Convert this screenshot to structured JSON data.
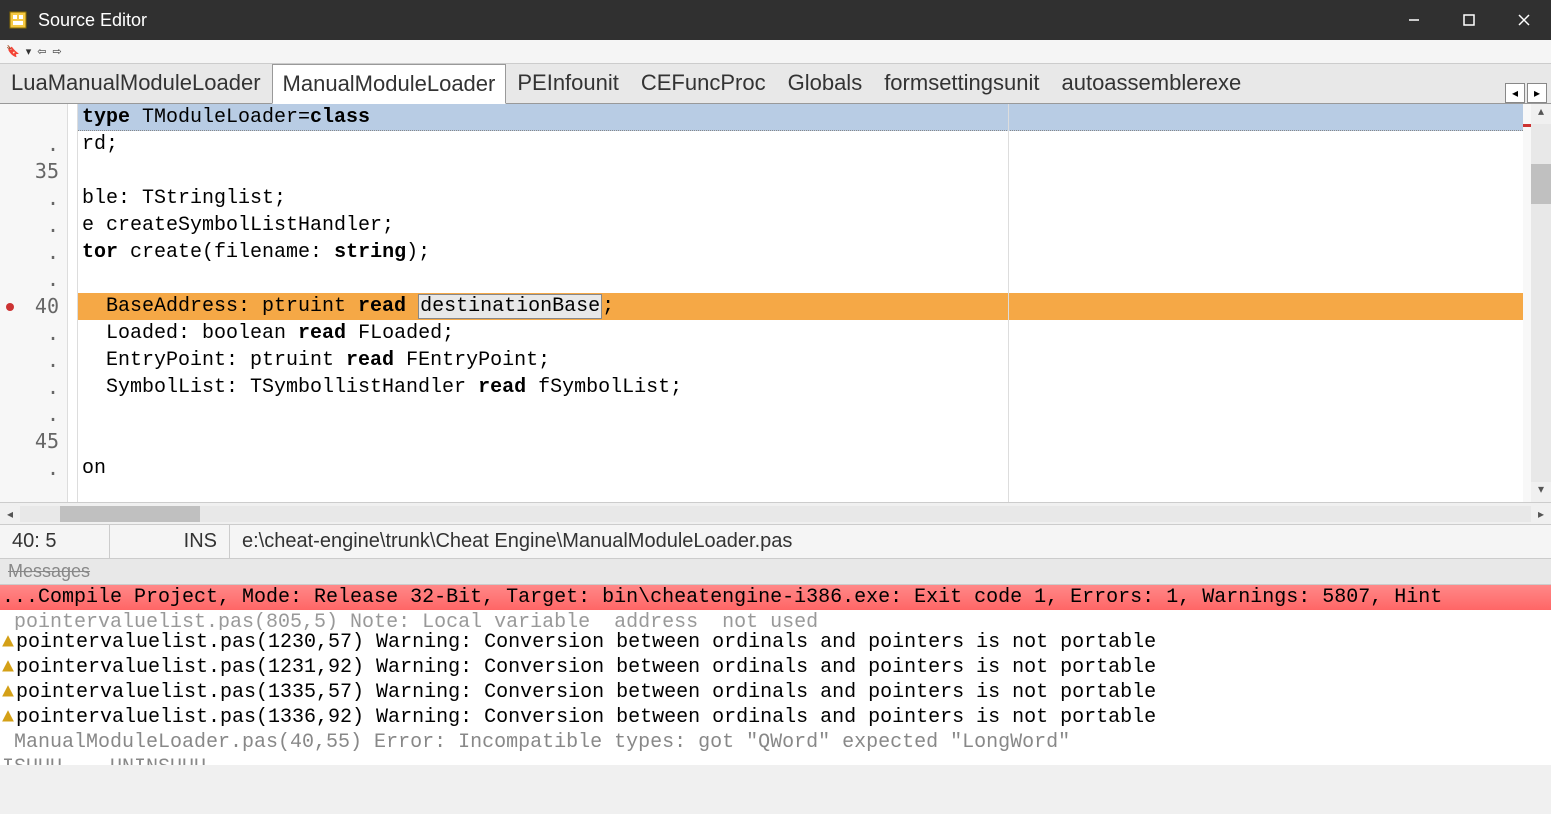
{
  "window": {
    "title": "Source Editor"
  },
  "tabs": {
    "items": [
      {
        "label": "LuaManualModuleLoader"
      },
      {
        "label": "ManualModuleLoader"
      },
      {
        "label": "PEInfounit"
      },
      {
        "label": "CEFuncProc"
      },
      {
        "label": "Globals"
      },
      {
        "label": "formsettingsunit"
      },
      {
        "label": "autoassemblerexe"
      }
    ],
    "active_index": 1
  },
  "editor": {
    "header": {
      "pre": "type ",
      "mid": "TModuleLoader=",
      "post": "class"
    },
    "lines": [
      {
        "num": ".",
        "text": "rd;"
      },
      {
        "num": "35",
        "text": ""
      },
      {
        "num": ".",
        "text": "ble: TStringlist;"
      },
      {
        "num": ".",
        "text": "e createSymbolListHandler;"
      },
      {
        "num": ".",
        "pre": "tor create(filename: ",
        "kw": "string",
        "post": ");"
      },
      {
        "num": ".",
        "text": ""
      },
      {
        "num": "40",
        "error": true,
        "hl": true,
        "pre": "  BaseAddress: ptruint ",
        "kw": "read",
        "cursor": "destinationBase",
        "post": ";"
      },
      {
        "num": ".",
        "pre": "  Loaded: boolean ",
        "kw": "read",
        "post": " FLoaded;"
      },
      {
        "num": ".",
        "pre": "  EntryPoint: ptruint ",
        "kw": "read",
        "post": " FEntryPoint;"
      },
      {
        "num": ".",
        "pre": "  SymbolList: TSymbollistHandler ",
        "kw": "read",
        "post": " fSymbolList;"
      },
      {
        "num": ".",
        "text": ""
      },
      {
        "num": "45",
        "text": ""
      },
      {
        "num": ".",
        "text": "on"
      }
    ]
  },
  "status": {
    "pos": "40: 5",
    "mode": "INS",
    "path": "e:\\cheat-engine\\trunk\\Cheat Engine\\ManualModuleLoader.pas"
  },
  "messages_title": "Messages",
  "messages": {
    "compile": "...Compile Project, Mode: Release 32-Bit, Target: bin\\cheatengine-i386.exe: Exit code 1, Errors: 1, Warnings: 5807, Hint",
    "faded": " pointervaluelist.pas(805,5) Note: Local variable  address  not used",
    "warnings": [
      "pointervaluelist.pas(1230,57) Warning: Conversion between ordinals and pointers is not portable",
      "pointervaluelist.pas(1231,92) Warning: Conversion between ordinals and pointers is not portable",
      "pointervaluelist.pas(1335,57) Warning: Conversion between ordinals and pointers is not portable",
      "pointervaluelist.pas(1336,92) Warning: Conversion between ordinals and pointers is not portable"
    ],
    "bottom": " ManualModuleLoader.pas(40,55) Error: Incompatible types: got \"QWord\" expected \"LongWord\"",
    "footer": "ISUUU.   UNINSUUU."
  }
}
